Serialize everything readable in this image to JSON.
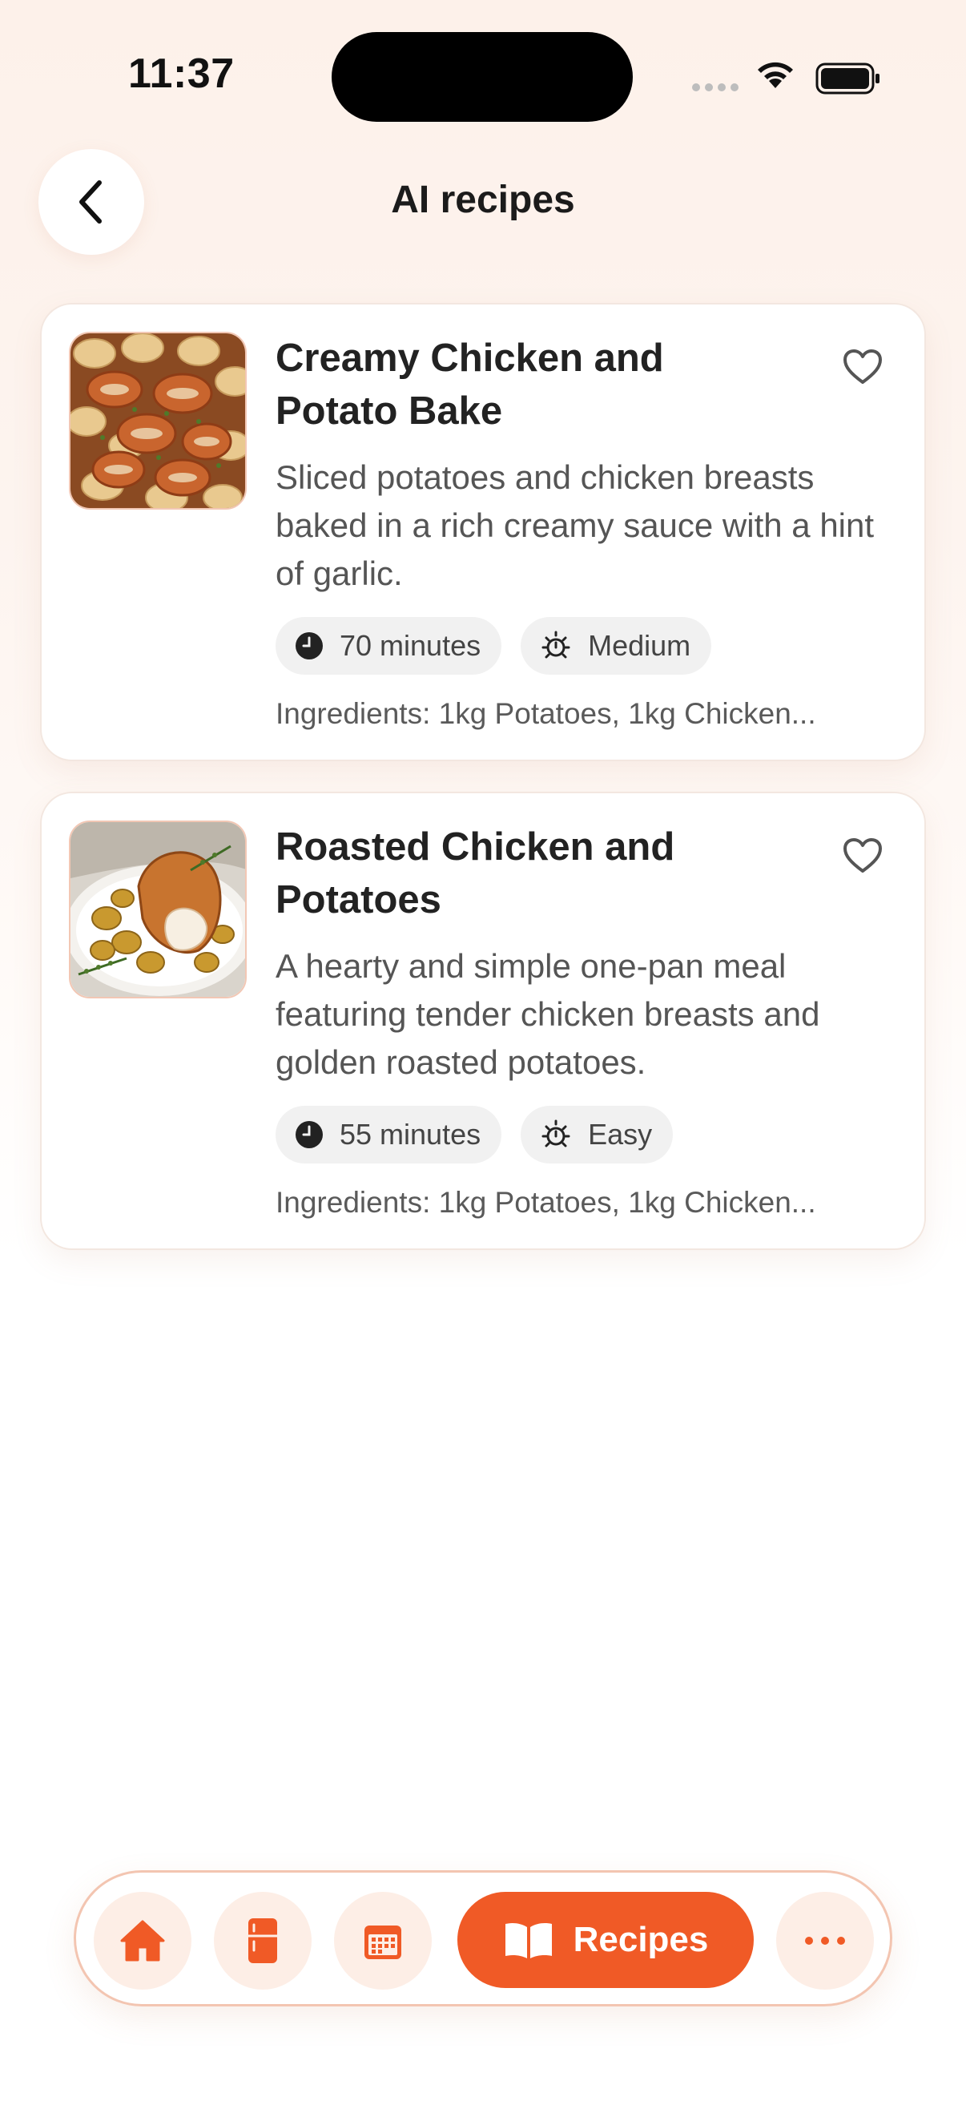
{
  "status_bar": {
    "time": "11:37"
  },
  "header": {
    "title": "AI recipes",
    "back_icon": "chevron-left-icon"
  },
  "recipes": [
    {
      "title": "Creamy Chicken and Potato Bake",
      "description": "Sliced potatoes and chicken breasts baked in a rich creamy sauce with a hint of garlic.",
      "time": "70 minutes",
      "difficulty": "Medium",
      "ingredients": "Ingredients: 1kg Potatoes, 1kg Chicken..."
    },
    {
      "title": "Roasted Chicken and Potatoes",
      "description": "A hearty and simple one-pan meal featuring tender chicken breasts and golden roasted potatoes.",
      "time": "55 minutes",
      "difficulty": "Easy",
      "ingredients": "Ingredients: 1kg Potatoes, 1kg Chicken..."
    }
  ],
  "bottom_nav": {
    "active_label": "Recipes",
    "items": [
      "home-icon",
      "fridge-icon",
      "calendar-icon",
      "recipes-book-icon",
      "more-icon"
    ]
  },
  "colors": {
    "accent": "#f05a26",
    "accent_soft": "#fdeee6",
    "chip_bg": "#f1f1f1"
  }
}
